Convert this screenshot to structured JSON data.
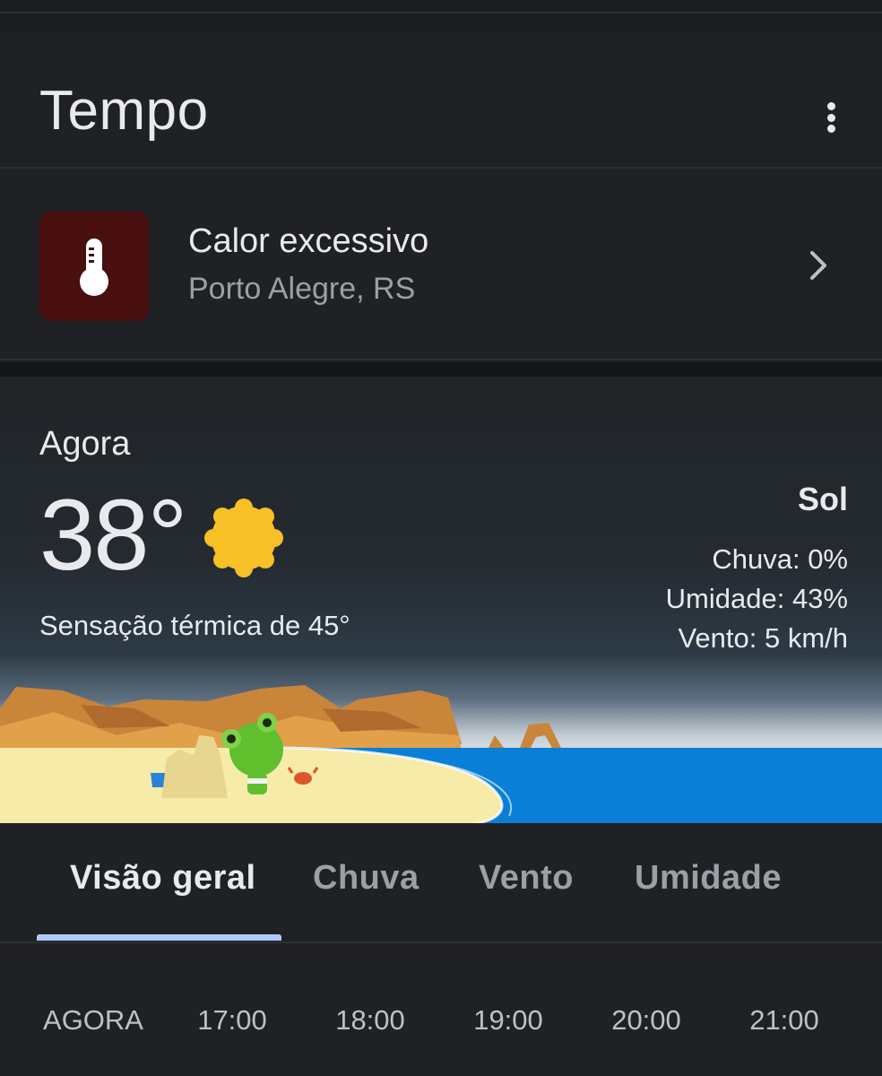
{
  "app": {
    "title": "Tempo"
  },
  "alert": {
    "title": "Calor excessivo",
    "location": "Porto Alegre, RS",
    "icon": "thermometer-icon",
    "icon_bg": "#4a0f0f"
  },
  "current": {
    "label": "Agora",
    "temperature": "38°",
    "feels_like": "Sensação térmica de 45°",
    "condition": "Sol",
    "condition_icon": "sun-icon",
    "rain": "Chuva: 0%",
    "humidity": "Umidade: 43%",
    "wind": "Vento: 5 km/h"
  },
  "tabs": [
    {
      "label": "Visão geral",
      "active": true
    },
    {
      "label": "Chuva",
      "active": false
    },
    {
      "label": "Vento",
      "active": false
    },
    {
      "label": "Umidade",
      "active": false
    }
  ],
  "hours": [
    "AGORA",
    "17:00",
    "18:00",
    "19:00",
    "20:00",
    "21:00"
  ],
  "colors": {
    "accent": "#aecbfa",
    "sun": "#f6c026",
    "sea": "#0a7fd6"
  }
}
